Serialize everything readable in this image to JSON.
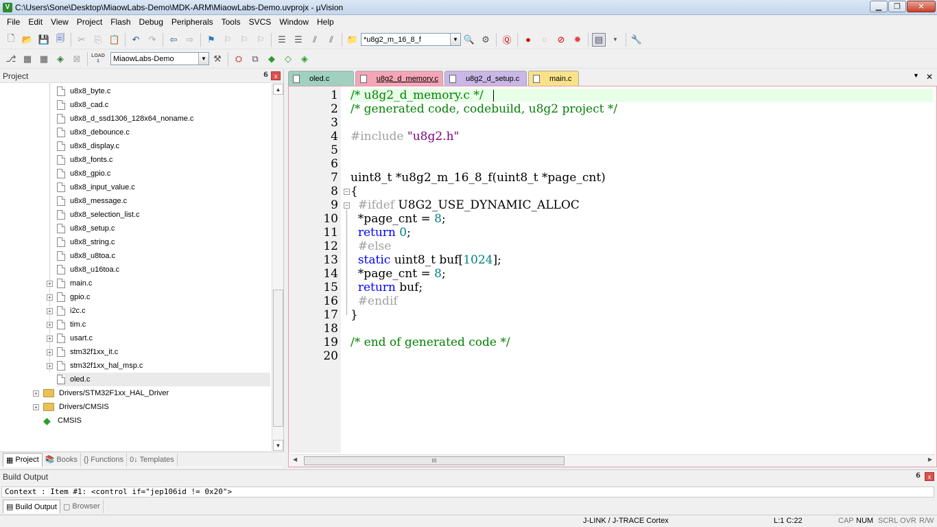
{
  "window": {
    "title": "C:\\Users\\Sone\\Desktop\\MiaowLabs-Demo\\MDK-ARM\\MiaowLabs-Demo.uvprojx - µVision",
    "app_icon": "V",
    "minimize": "▁",
    "maximize": "❐",
    "close": "✕"
  },
  "menu": [
    "File",
    "Edit",
    "View",
    "Project",
    "Flash",
    "Debug",
    "Peripherals",
    "Tools",
    "SVCS",
    "Window",
    "Help"
  ],
  "toolbar": {
    "find_combo_value": "*u8g2_m_16_8_f",
    "target_combo_value": "MiaowLabs-Demo",
    "load_label": "LOAD"
  },
  "project_panel": {
    "title": "Project",
    "pin": "𝟲",
    "close": "x",
    "tree": [
      {
        "label": "u8x8_byte.c",
        "type": "file",
        "expander": ""
      },
      {
        "label": "u8x8_cad.c",
        "type": "file",
        "expander": ""
      },
      {
        "label": "u8x8_d_ssd1306_128x64_noname.c",
        "type": "file",
        "expander": ""
      },
      {
        "label": "u8x8_debounce.c",
        "type": "file",
        "expander": ""
      },
      {
        "label": "u8x8_display.c",
        "type": "file",
        "expander": ""
      },
      {
        "label": "u8x8_fonts.c",
        "type": "file",
        "expander": ""
      },
      {
        "label": "u8x8_gpio.c",
        "type": "file",
        "expander": ""
      },
      {
        "label": "u8x8_input_value.c",
        "type": "file",
        "expander": ""
      },
      {
        "label": "u8x8_message.c",
        "type": "file",
        "expander": ""
      },
      {
        "label": "u8x8_selection_list.c",
        "type": "file",
        "expander": ""
      },
      {
        "label": "u8x8_setup.c",
        "type": "file",
        "expander": ""
      },
      {
        "label": "u8x8_string.c",
        "type": "file",
        "expander": ""
      },
      {
        "label": "u8x8_u8toa.c",
        "type": "file",
        "expander": ""
      },
      {
        "label": "u8x8_u16toa.c",
        "type": "file",
        "expander": ""
      },
      {
        "label": "main.c",
        "type": "file",
        "expander": "+"
      },
      {
        "label": "gpio.c",
        "type": "file",
        "expander": "+"
      },
      {
        "label": "i2c.c",
        "type": "file",
        "expander": "+"
      },
      {
        "label": "tim.c",
        "type": "file",
        "expander": "+"
      },
      {
        "label": "usart.c",
        "type": "file",
        "expander": "+"
      },
      {
        "label": "stm32f1xx_it.c",
        "type": "file",
        "expander": "+"
      },
      {
        "label": "stm32f1xx_hal_msp.c",
        "type": "file",
        "expander": "+"
      },
      {
        "label": "oled.c",
        "type": "file",
        "expander": ""
      },
      {
        "label": "Drivers/STM32F1xx_HAL_Driver",
        "type": "folder",
        "expander": "+"
      },
      {
        "label": "Drivers/CMSIS",
        "type": "folder",
        "expander": "+"
      },
      {
        "label": "CMSIS",
        "type": "cmsis",
        "expander": ""
      }
    ],
    "bottom_tabs": [
      {
        "label": "Project",
        "icon": "▦"
      },
      {
        "label": "Books",
        "icon": "📚"
      },
      {
        "label": "Functions",
        "icon": "{}"
      },
      {
        "label": "Templates",
        "icon": "0↓"
      }
    ]
  },
  "editor": {
    "tabs": [
      {
        "label": "oled.c",
        "color": "#9fd0c0"
      },
      {
        "label": "u8g2_d_memory.c",
        "color": "#f4a6b6"
      },
      {
        "label": "u8g2_d_setup.c",
        "color": "#c9b7e6"
      },
      {
        "label": "main.c",
        "color": "#f9e28a"
      }
    ],
    "tab_menu": "▼",
    "tab_close": "✕",
    "line_numbers": [
      "1",
      "2",
      "3",
      "4",
      "5",
      "6",
      "7",
      "8",
      "9",
      "10",
      "11",
      "12",
      "13",
      "14",
      "15",
      "16",
      "17",
      "18",
      "19",
      "20"
    ],
    "lines": [
      [
        {
          "t": "/* u8g2_d_memory.c */",
          "c": "comment"
        }
      ],
      [
        {
          "t": "/* generated code, codebuild, u8g2 project */",
          "c": "comment"
        }
      ],
      [],
      [
        {
          "t": "#include ",
          "c": "pre"
        },
        {
          "t": "\"u8g2.h\"",
          "c": "str"
        }
      ],
      [],
      [],
      [
        {
          "t": "uint8_t *u8g2_m_16_8_f(uint8_t *page_cnt)",
          "c": "plain"
        }
      ],
      [
        {
          "t": "{",
          "c": "plain"
        }
      ],
      [
        {
          "t": "  #ifdef ",
          "c": "pre"
        },
        {
          "t": "U8G2_USE_DYNAMIC_ALLOC",
          "c": "plain"
        }
      ],
      [
        {
          "t": "  *page_cnt = ",
          "c": "plain"
        },
        {
          "t": "8",
          "c": "num"
        },
        {
          "t": ";",
          "c": "plain"
        }
      ],
      [
        {
          "t": "  ",
          "c": "plain"
        },
        {
          "t": "return",
          "c": "kw"
        },
        {
          "t": " ",
          "c": "plain"
        },
        {
          "t": "0",
          "c": "num"
        },
        {
          "t": ";",
          "c": "plain"
        }
      ],
      [
        {
          "t": "  #else",
          "c": "pre"
        }
      ],
      [
        {
          "t": "  ",
          "c": "plain"
        },
        {
          "t": "static",
          "c": "kw"
        },
        {
          "t": " uint8_t buf[",
          "c": "plain"
        },
        {
          "t": "1024",
          "c": "num"
        },
        {
          "t": "];",
          "c": "plain"
        }
      ],
      [
        {
          "t": "  *page_cnt = ",
          "c": "plain"
        },
        {
          "t": "8",
          "c": "num"
        },
        {
          "t": ";",
          "c": "plain"
        }
      ],
      [
        {
          "t": "  ",
          "c": "plain"
        },
        {
          "t": "return",
          "c": "kw"
        },
        {
          "t": " buf;",
          "c": "plain"
        }
      ],
      [
        {
          "t": "  #endif",
          "c": "pre"
        }
      ],
      [
        {
          "t": "}",
          "c": "plain"
        }
      ],
      [],
      [
        {
          "t": "/* end of generated code */",
          "c": "comment"
        }
      ],
      []
    ],
    "hscroll_grip": "III"
  },
  "build_output": {
    "title": "Build Output",
    "pin": "𝟲",
    "close": "x",
    "text": "Context      : Item #1: <control if=\"jep106id != 0x20\">",
    "tabs": [
      {
        "label": "Build Output",
        "icon": "▤"
      },
      {
        "label": "Browser",
        "icon": "▢"
      }
    ]
  },
  "statusbar": {
    "debugger": "J-LINK / J-TRACE Cortex",
    "position": "L:1 C:22",
    "indicators": [
      "CAP",
      "NUM",
      "SCRL",
      "OVR",
      "R/W"
    ]
  },
  "colors": {
    "current_line": "#e8ffe8",
    "comment": "#008000",
    "keyword": "#0000ff",
    "number": "#008080",
    "string": "#800080",
    "preprocessor": "#a0a0a0"
  }
}
